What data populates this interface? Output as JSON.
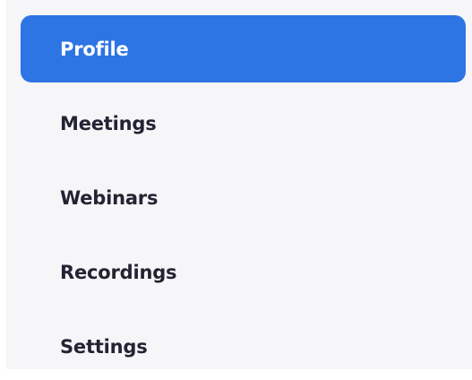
{
  "sidebar": {
    "active_color": "#2d74e4",
    "items": [
      {
        "label": "Profile",
        "active": true
      },
      {
        "label": "Meetings",
        "active": false
      },
      {
        "label": "Webinars",
        "active": false
      },
      {
        "label": "Recordings",
        "active": false
      },
      {
        "label": "Settings",
        "active": false
      }
    ]
  }
}
